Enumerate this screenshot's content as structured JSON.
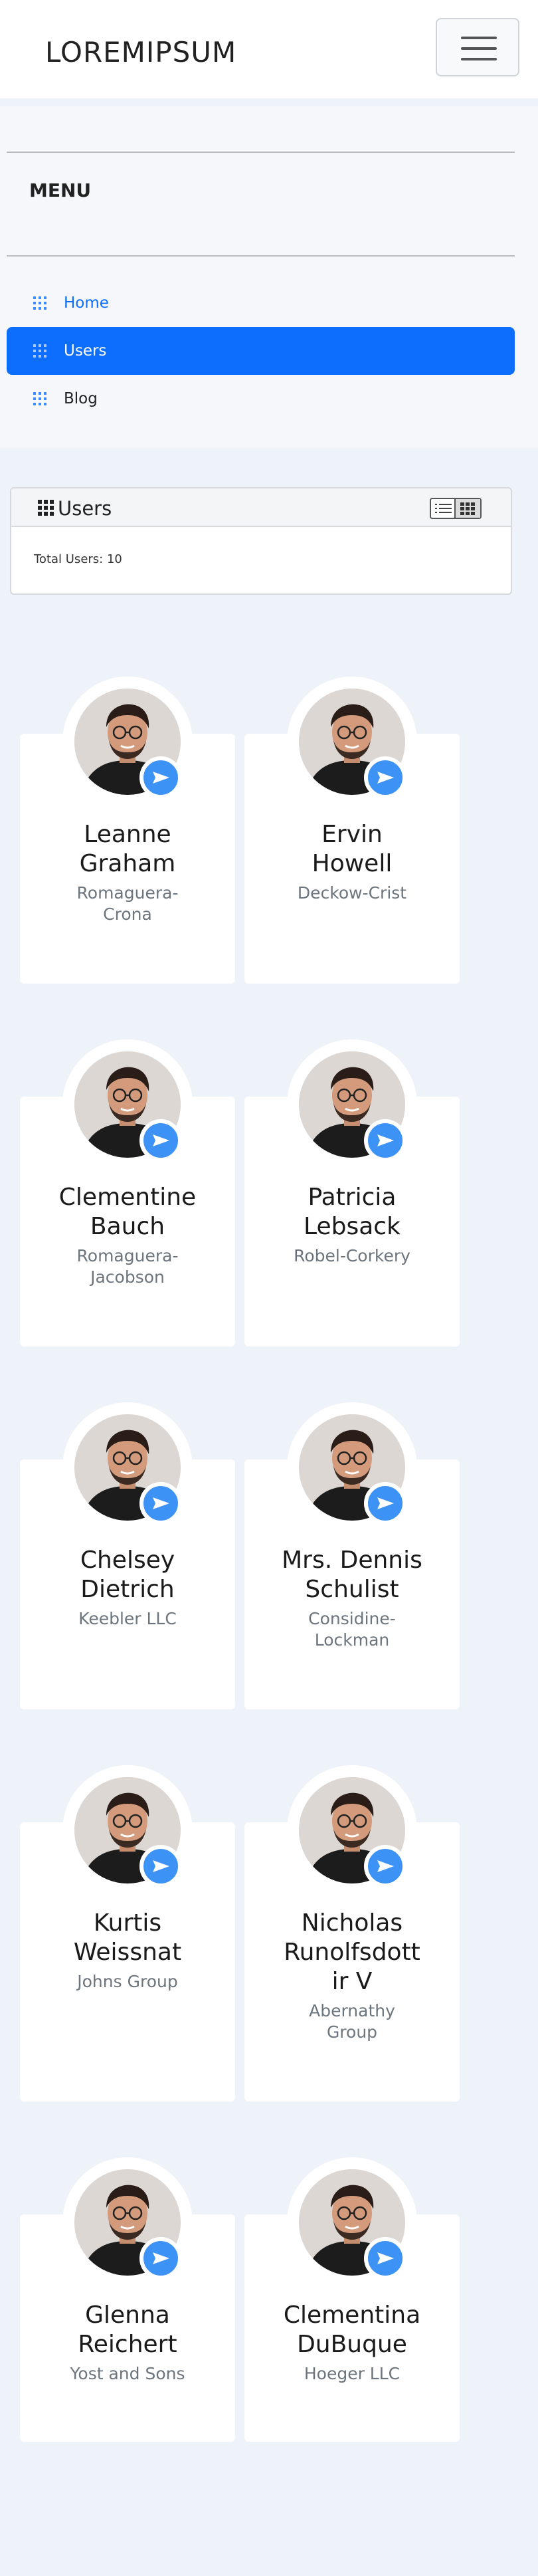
{
  "brand": "LOREMIPSUM",
  "menu": {
    "title": "MENU",
    "items": [
      {
        "label": "Home"
      },
      {
        "label": "Users"
      },
      {
        "label": "Blog"
      }
    ]
  },
  "panel": {
    "title": "Users",
    "total_text": "Total Users: 10"
  },
  "colors": {
    "accent": "#0d6efd",
    "badge": "#3d93f5",
    "page_bg": "#eef2f9"
  },
  "users": [
    {
      "name": "Leanne Graham",
      "name_lines": [
        "Leanne",
        "Graham"
      ],
      "company_lines": [
        "Romaguera-",
        "Crona"
      ]
    },
    {
      "name": "Ervin Howell",
      "name_lines": [
        "Ervin",
        "Howell"
      ],
      "company_lines": [
        "Deckow-Crist"
      ]
    },
    {
      "name": "Clementine Bauch",
      "name_lines": [
        "Clementine",
        "Bauch"
      ],
      "company_lines": [
        "Romaguera-",
        "Jacobson"
      ]
    },
    {
      "name": "Patricia Lebsack",
      "name_lines": [
        "Patricia",
        "Lebsack"
      ],
      "company_lines": [
        "Robel-Corkery"
      ]
    },
    {
      "name": "Chelsey Dietrich",
      "name_lines": [
        "Chelsey",
        "Dietrich"
      ],
      "company_lines": [
        "Keebler LLC"
      ]
    },
    {
      "name": "Mrs. Dennis Schulist",
      "name_lines": [
        "Mrs. Dennis",
        "Schulist"
      ],
      "company_lines": [
        "Considine-",
        "Lockman"
      ]
    },
    {
      "name": "Kurtis Weissnat",
      "name_lines": [
        "Kurtis",
        "Weissnat"
      ],
      "company_lines": [
        "Johns Group"
      ]
    },
    {
      "name": "Nicholas Runolfsdottir V",
      "name_lines": [
        "Nicholas",
        "Runolfsdott",
        "ir V"
      ],
      "company_lines": [
        "Abernathy",
        "Group"
      ]
    },
    {
      "name": "Glenna Reichert",
      "name_lines": [
        "Glenna",
        "Reichert"
      ],
      "company_lines": [
        "Yost and Sons"
      ]
    },
    {
      "name": "Clementina DuBuque",
      "name_lines": [
        "Clementina",
        "DuBuque"
      ],
      "company_lines": [
        "Hoeger LLC"
      ]
    }
  ]
}
